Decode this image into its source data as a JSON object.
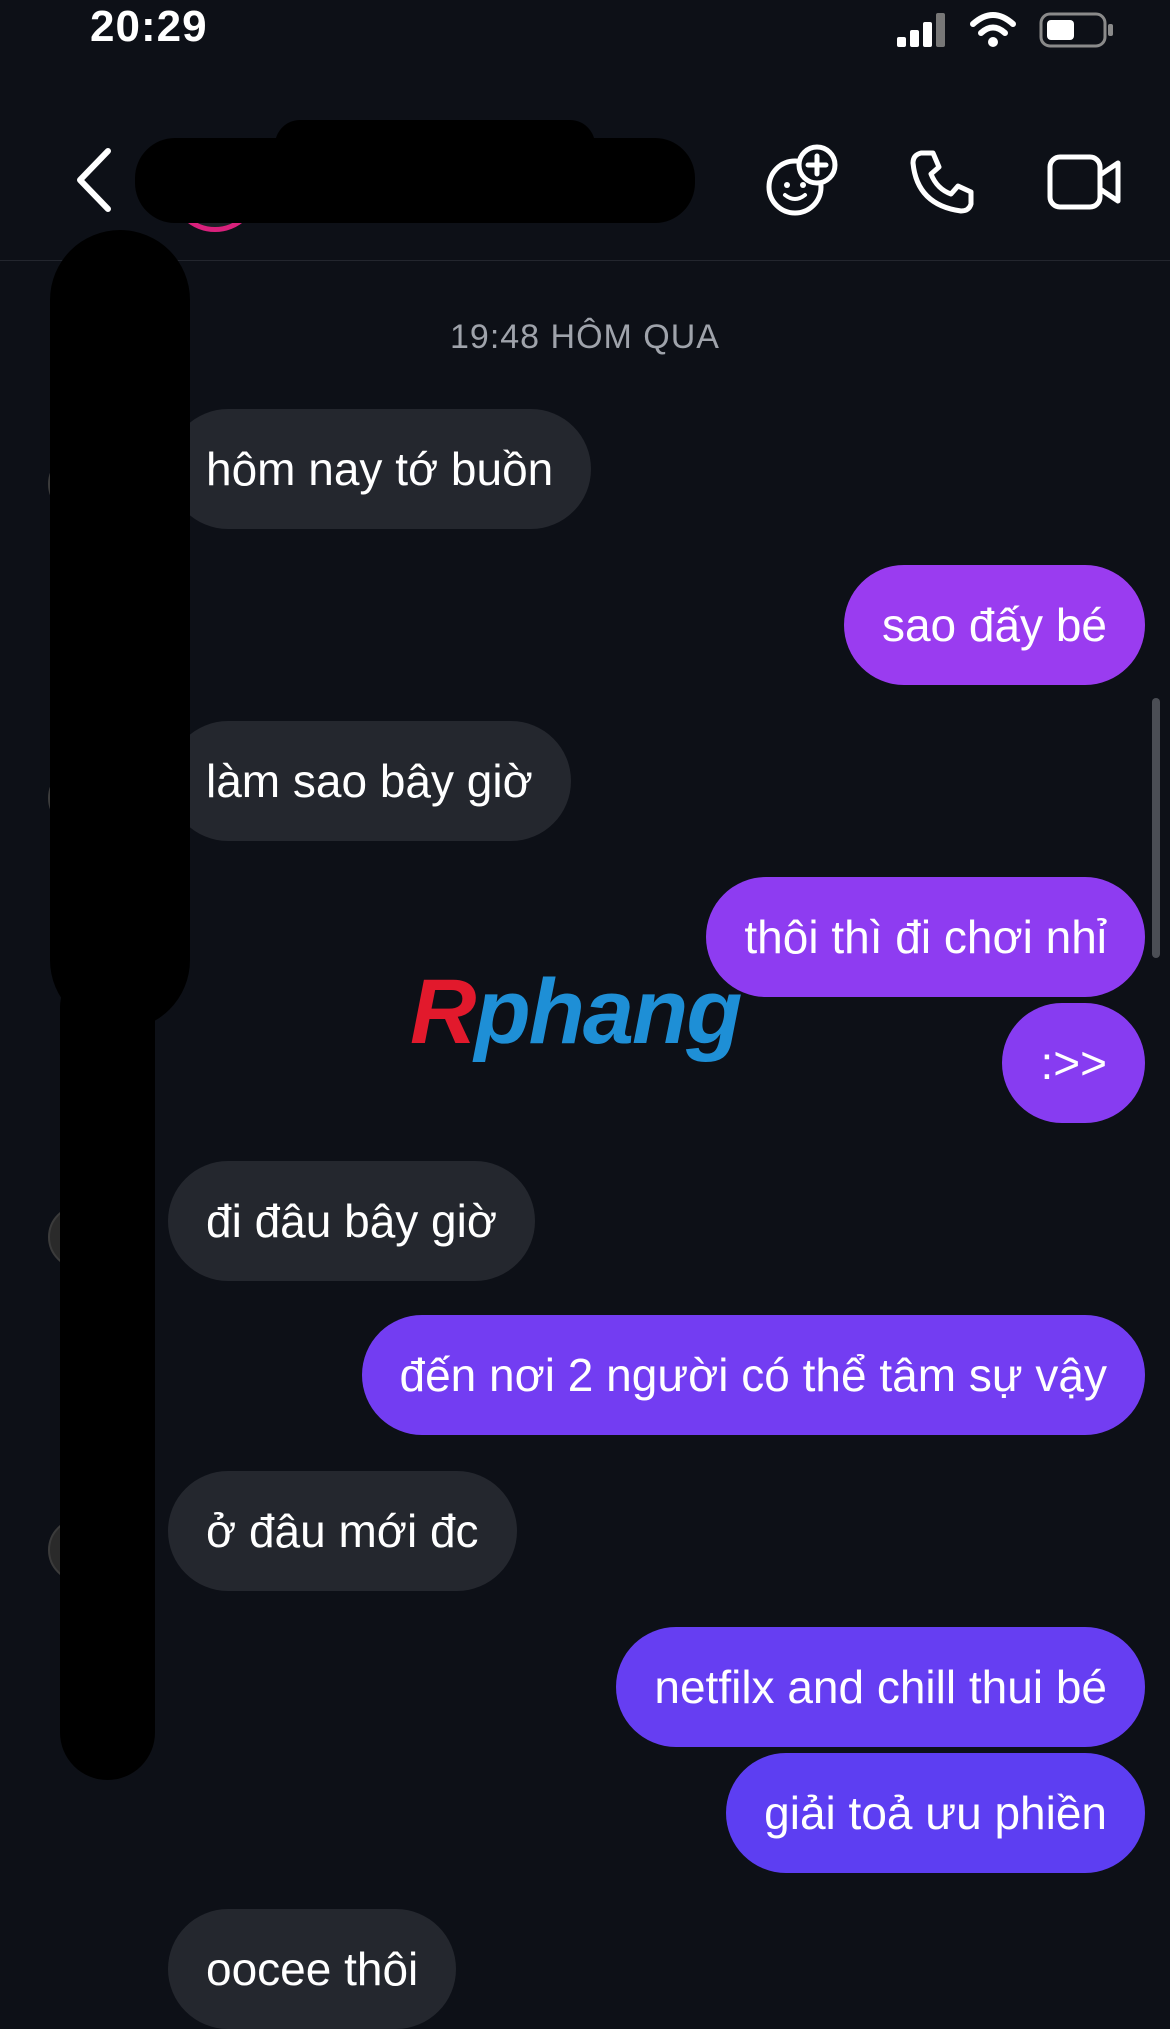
{
  "status_bar": {
    "time": "20:29"
  },
  "header": {
    "contact_name": ""
  },
  "conversation": {
    "timestamp": "19:48 HÔM QUA",
    "messages": [
      {
        "side": "in",
        "text": "hôm nay tớ buồn"
      },
      {
        "side": "out",
        "text": "sao đấy bé"
      },
      {
        "side": "in",
        "text": "làm sao bây giờ"
      },
      {
        "side": "out",
        "text": "thôi thì đi chơi nhỉ"
      },
      {
        "side": "out",
        "text": ":>>"
      },
      {
        "side": "in",
        "text": "đi đâu bây giờ"
      },
      {
        "side": "out",
        "text": "đến nơi 2 người có thể tâm sự vậy"
      },
      {
        "side": "in",
        "text": "ở đâu mới đc"
      },
      {
        "side": "out",
        "text": "netfilx and chill thui bé"
      },
      {
        "side": "out",
        "text": "giải toả ưu phiền"
      },
      {
        "side": "in",
        "text": "oocee thôi"
      }
    ]
  },
  "watermark": {
    "first": "R",
    "rest": "phang"
  },
  "colors": {
    "background": "#0d1017",
    "incoming_bubble": "#24272e",
    "outgoing_top": "#9a3cf0",
    "outgoing_bottom": "#5d3ef2",
    "timestamp_text": "#9fa3ab"
  },
  "icons": {
    "back": "chevron-left-icon",
    "effects": "sticker-plus-icon",
    "call": "phone-icon",
    "video": "video-camera-icon"
  }
}
